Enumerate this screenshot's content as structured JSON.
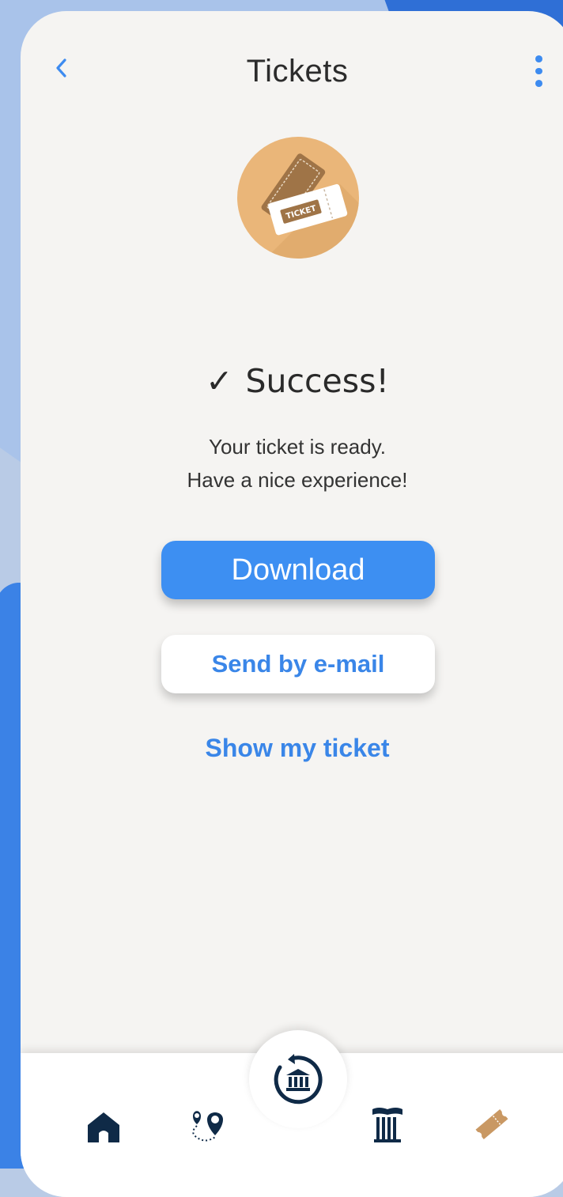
{
  "header": {
    "title": "Tickets",
    "back_icon": "chevron-left-icon",
    "menu_icon": "vertical-dots-icon"
  },
  "hero": {
    "icon": "ticket-icon",
    "ticket_text": "TICKET"
  },
  "status": {
    "check": "✓",
    "heading": "Success!",
    "line1": "Your ticket is ready.",
    "line2": "Have a nice experience!"
  },
  "actions": {
    "download_label": "Download",
    "email_label": "Send by e-mail",
    "show_ticket_label": "Show my ticket"
  },
  "tabbar": {
    "items": [
      {
        "icon": "home-icon",
        "active": false
      },
      {
        "icon": "route-icon",
        "active": false
      },
      {
        "icon": "museum-icon",
        "active": false
      },
      {
        "icon": "tickets-icon",
        "active": true
      }
    ],
    "center_icon": "museum-history-icon"
  },
  "colors": {
    "accent": "#3d8ff2",
    "link": "#3a86e8",
    "navy": "#0f2a47",
    "ticket_tab": "#c99863",
    "avatar_bg": "#eab679",
    "screen_bg": "#f5f4f2"
  }
}
